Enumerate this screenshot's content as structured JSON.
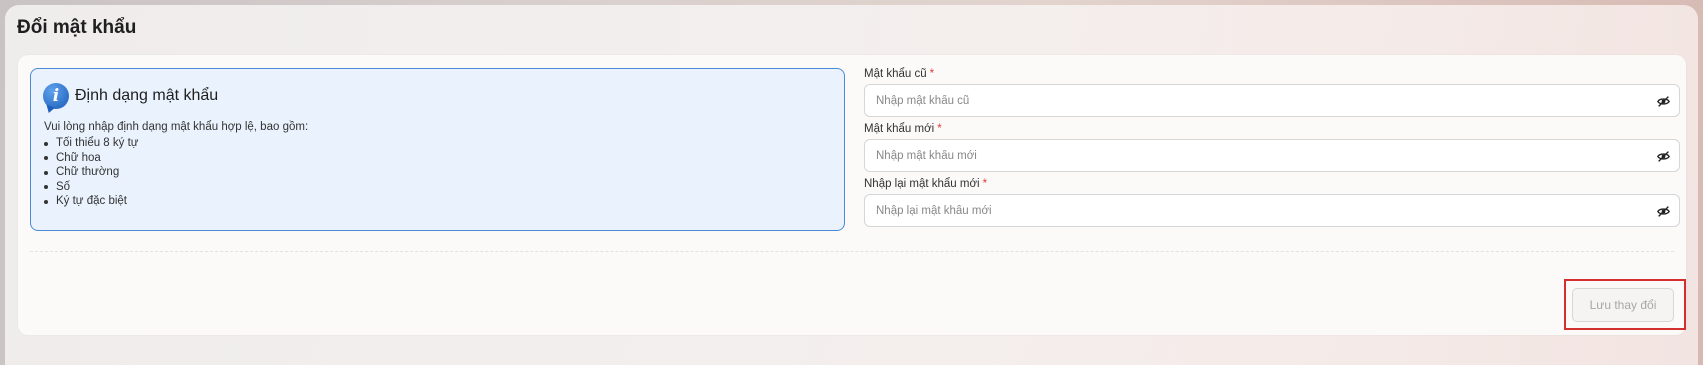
{
  "page": {
    "title": "Đổi mật khẩu"
  },
  "info": {
    "icon": "info-icon",
    "title": "Định dạng mật khẩu",
    "description": "Vui lòng nhập định dạng mật khẩu hợp lệ, bao gồm:",
    "rules": [
      "Tối thiểu 8 ký tự",
      "Chữ hoa",
      "Chữ thường",
      "Số",
      "Ký tự đặc biệt"
    ]
  },
  "form": {
    "old_password": {
      "label": "Mật khẩu cũ",
      "required": "*",
      "placeholder": "Nhập mật khẩu cũ",
      "value": ""
    },
    "new_password": {
      "label": "Mật khẩu mới",
      "required": "*",
      "placeholder": "Nhập mật khẩu mới",
      "value": ""
    },
    "confirm_password": {
      "label": "Nhập lại mật khẩu mới",
      "required": "*",
      "placeholder": "Nhập lại mật khẩu mới",
      "value": ""
    },
    "visibility_icon": "eye-off-icon"
  },
  "actions": {
    "save_label": "Lưu thay đổi"
  },
  "colors": {
    "accent": "#4a8ad6",
    "required": "#e53935",
    "highlight": "#d32f2f"
  }
}
